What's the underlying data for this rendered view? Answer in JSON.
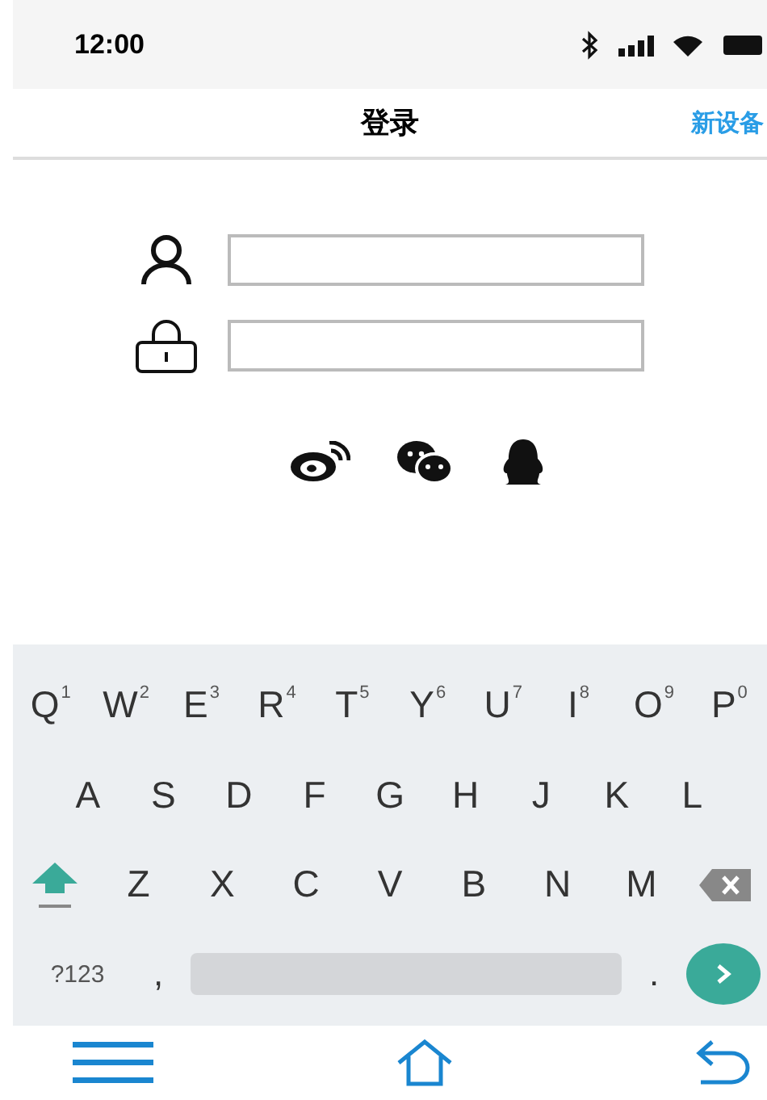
{
  "status_bar": {
    "time": "12:00"
  },
  "nav_bar": {
    "title": "登录",
    "action": "新设备"
  },
  "form": {
    "fields": [
      {
        "kind": "user"
      },
      {
        "kind": "password"
      }
    ]
  },
  "keyboard": {
    "letter_rows": [
      [
        {
          "label": "Q",
          "hint": "1"
        },
        {
          "label": "W",
          "hint": "2"
        },
        {
          "label": "E",
          "hint": "3"
        },
        {
          "label": "R",
          "hint": "4"
        },
        {
          "label": "T",
          "hint": "5"
        },
        {
          "label": "Y",
          "hint": "6"
        },
        {
          "label": "U",
          "hint": "7"
        },
        {
          "label": "I",
          "hint": "8"
        },
        {
          "label": "O",
          "hint": "9"
        },
        {
          "label": "P",
          "hint": "0"
        }
      ],
      [
        {
          "label": "A"
        },
        {
          "label": "S"
        },
        {
          "label": "D"
        },
        {
          "label": "F"
        },
        {
          "label": "G"
        },
        {
          "label": "H"
        },
        {
          "label": "J"
        },
        {
          "label": "K"
        },
        {
          "label": "L"
        }
      ],
      [
        {
          "label": "Z"
        },
        {
          "label": "X"
        },
        {
          "label": "C"
        },
        {
          "label": "V"
        },
        {
          "label": "B"
        },
        {
          "label": "N"
        },
        {
          "label": "M"
        }
      ]
    ],
    "symbols_key": "?123",
    "comma_key": ",",
    "period_key": "."
  }
}
